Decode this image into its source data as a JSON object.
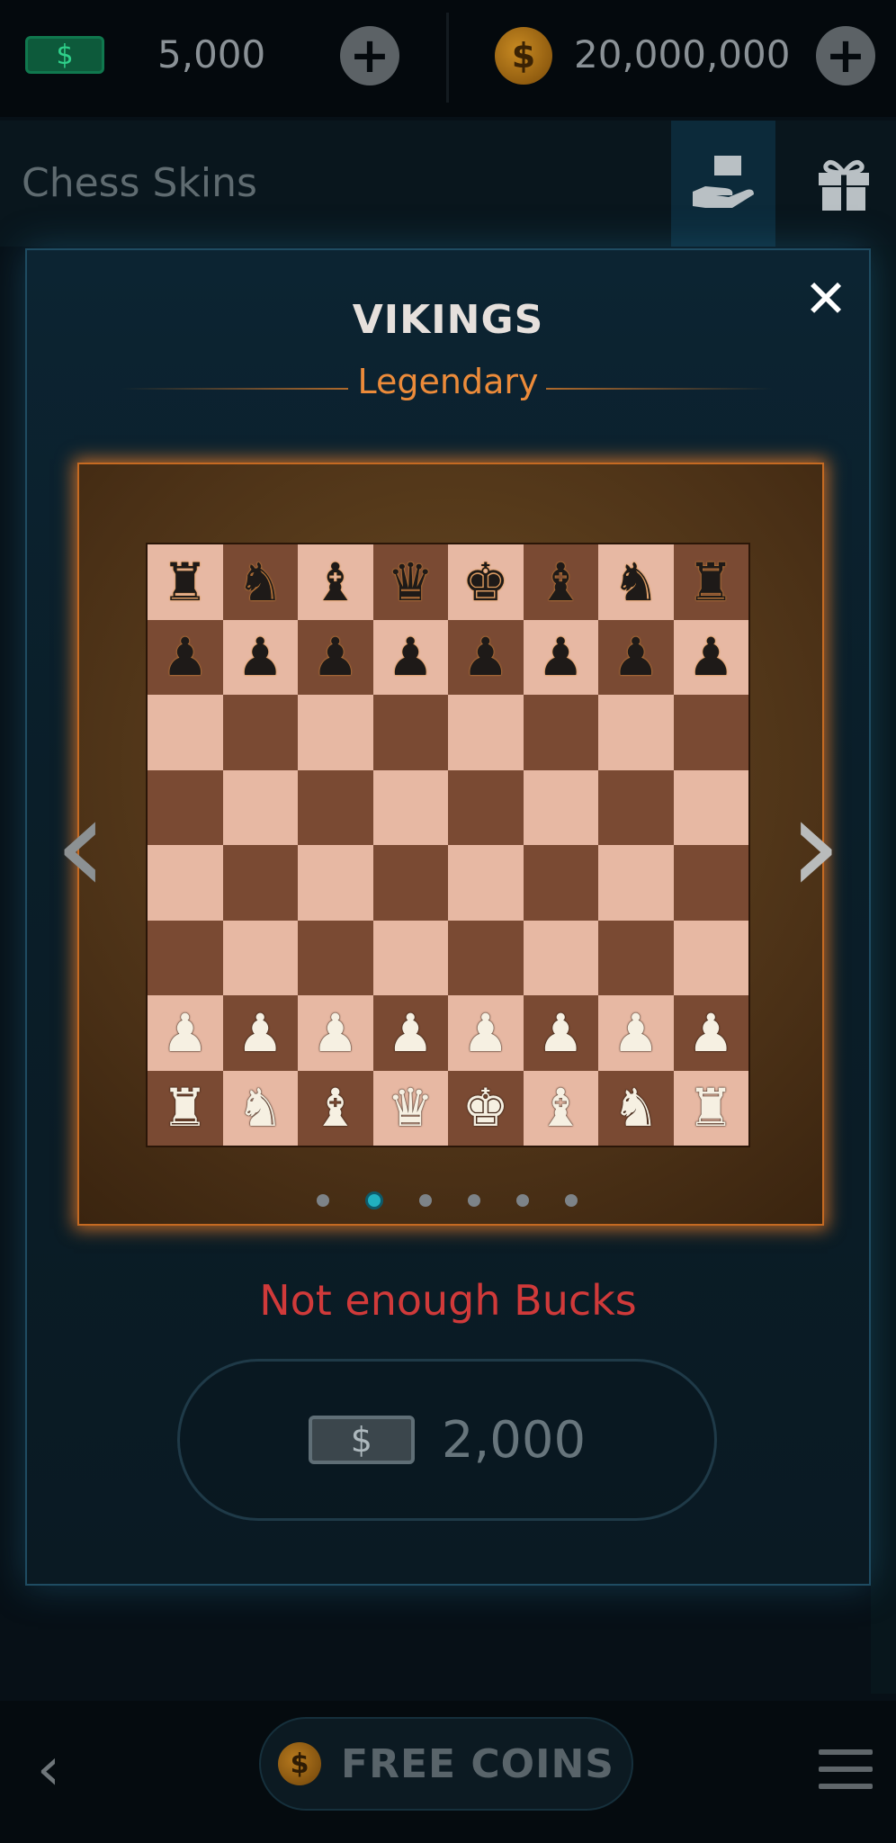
{
  "currency": {
    "bucks_icon_symbol": "$",
    "bucks_amount": "5,000",
    "bucks_add_label": "+",
    "coins_icon_symbol": "$",
    "coins_amount": "20,000,000",
    "coins_add_label": "+"
  },
  "header": {
    "title": "Chess Skins",
    "icons": [
      "hand-offer-icon",
      "gift-icon"
    ]
  },
  "modal": {
    "close_label": "✕",
    "skin_name": "VIKINGS",
    "rarity": "Legendary",
    "rarity_color": "#ec8b3a",
    "prev_label": "‹",
    "next_label": "›",
    "page_dots": {
      "count": 6,
      "active_index": 1
    },
    "warning": "Not enough Bucks",
    "warning_color": "#d03a3a",
    "price": {
      "icon_symbol": "$",
      "amount": "2,000"
    },
    "board": {
      "rows": [
        [
          "br",
          "bn",
          "bb",
          "bq",
          "bk",
          "bb",
          "bn",
          "br"
        ],
        [
          "bp",
          "bp",
          "bp",
          "bp",
          "bp",
          "bp",
          "bp",
          "bp"
        ],
        [
          "",
          "",
          "",
          "",
          "",
          "",
          "",
          ""
        ],
        [
          "",
          "",
          "",
          "",
          "",
          "",
          "",
          ""
        ],
        [
          "",
          "",
          "",
          "",
          "",
          "",
          "",
          ""
        ],
        [
          "",
          "",
          "",
          "",
          "",
          "",
          "",
          ""
        ],
        [
          "wp",
          "wp",
          "wp",
          "wp",
          "wp",
          "wp",
          "wp",
          "wp"
        ],
        [
          "wr",
          "wn",
          "wb",
          "wq",
          "wk",
          "wb",
          "wn",
          "wr"
        ]
      ]
    }
  },
  "bottom": {
    "back_label": "‹",
    "free_coins_icon_symbol": "$",
    "free_coins_label": "FREE COINS"
  }
}
